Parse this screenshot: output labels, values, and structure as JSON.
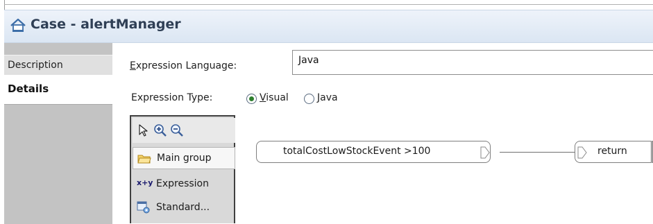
{
  "title": {
    "text": "Case - alertManager",
    "icon": "case-house-icon"
  },
  "tabs": [
    {
      "label": "Description"
    },
    {
      "label": "Details"
    }
  ],
  "expression_language": {
    "label": "Expression Language:",
    "value": "Java"
  },
  "expression_type": {
    "label": "Expression Type:",
    "options": [
      {
        "label": "Visual",
        "selected": true
      },
      {
        "label": "Java",
        "selected": false
      }
    ]
  },
  "palette": {
    "tools": [
      "selection-arrow-icon",
      "zoom-in-icon",
      "zoom-out-icon"
    ],
    "items": [
      {
        "label": "Main group",
        "icon": "folder-icon"
      },
      {
        "label": "Expression",
        "icon": "xy-expression-icon"
      },
      {
        "label": "Standard...",
        "icon": "standard-function-icon"
      }
    ]
  },
  "canvas": {
    "expression_node": "totalCostLowStockEvent >100",
    "return_node": "return"
  },
  "colors": {
    "title_text": "#2f3f55",
    "tab_background": "#c3c3c3",
    "radio_selected": "#2d7f2d"
  }
}
